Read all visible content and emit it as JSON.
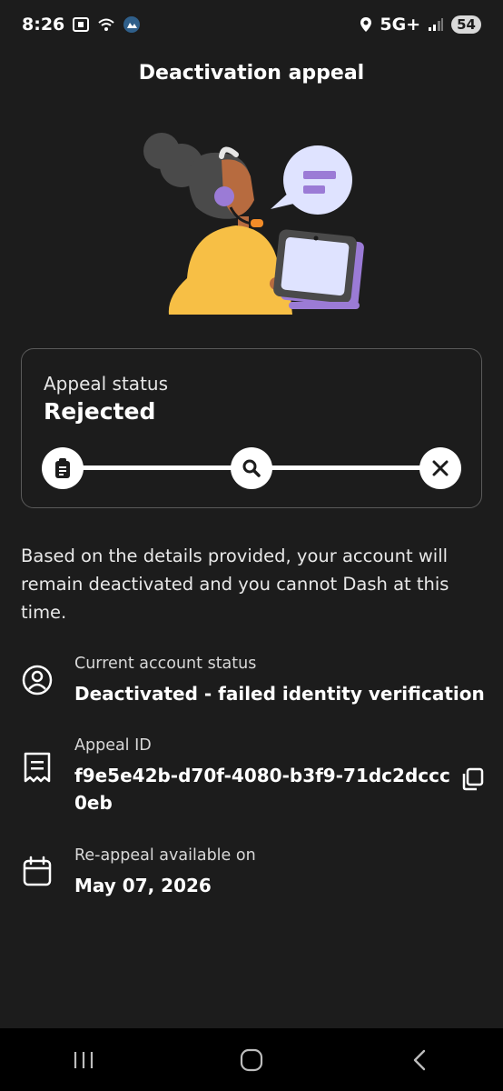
{
  "status_bar": {
    "time": "8:26",
    "network": "5G+",
    "battery": "54"
  },
  "page": {
    "title": "Deactivation appeal"
  },
  "appeal_card": {
    "label": "Appeal status",
    "status": "Rejected",
    "steps": [
      "clipboard-icon",
      "search-icon",
      "close-icon"
    ]
  },
  "description": "Based on the details provided, your account will remain deactivated and you cannot Dash at this time.",
  "details": {
    "account_status": {
      "label": "Current account status",
      "value": "Deactivated - failed identity verification"
    },
    "appeal_id": {
      "label": "Appeal ID",
      "value_line1": "f9e5e42b-d70f-4080-b3f9-71dc2dccc",
      "value_line2": "0eb"
    },
    "reappeal": {
      "label": "Re-appeal available on",
      "value": "May 07, 2026"
    }
  },
  "colors": {
    "background": "#1c1c1c",
    "hair": "#4a4a4a",
    "skin": "#b76b3f",
    "shirt": "#f7bf45",
    "accent": "#9b7bd6",
    "laptop_screen": "#dfe3ff",
    "orange": "#f28c28"
  }
}
